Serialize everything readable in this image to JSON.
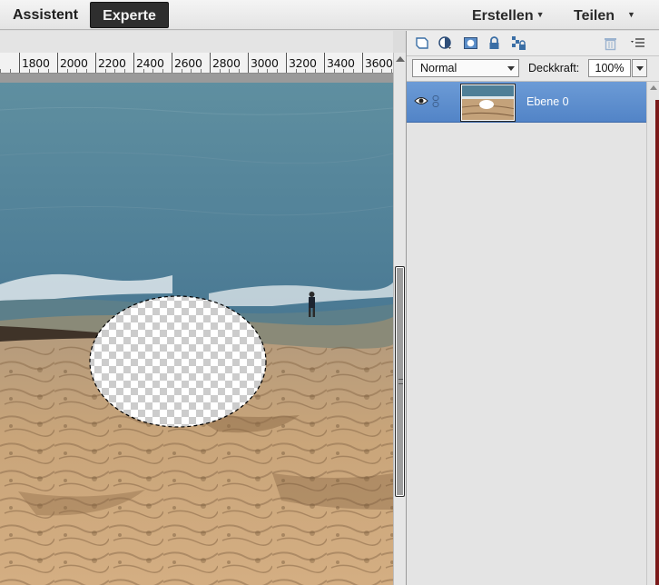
{
  "modes": {
    "assistent": "Assistent",
    "experte": "Experte"
  },
  "menus": {
    "erstellen": "Erstellen",
    "teilen": "Teilen"
  },
  "ruler": {
    "labels": [
      "00",
      "1800",
      "2000",
      "2200",
      "2400",
      "2600",
      "2800",
      "3000",
      "3200",
      "3400",
      "3600"
    ]
  },
  "layers_panel": {
    "toolbar_icons": [
      "new-layer-icon",
      "adjustment-layer-icon",
      "layer-mask-icon",
      "lock-icon",
      "lock-transparency-icon",
      "trash-icon",
      "panel-menu-icon"
    ],
    "blend_mode": "Normal",
    "opacity_label": "Deckkraft:",
    "opacity_value": "100%",
    "layers": [
      {
        "name": "Ebene 0",
        "visible": true,
        "selected": true
      }
    ]
  },
  "colors": {
    "selected_layer": "#5f8fcf",
    "active_mode_tab": "#2e2e2e",
    "panel_bg": "#e2e2e2"
  }
}
